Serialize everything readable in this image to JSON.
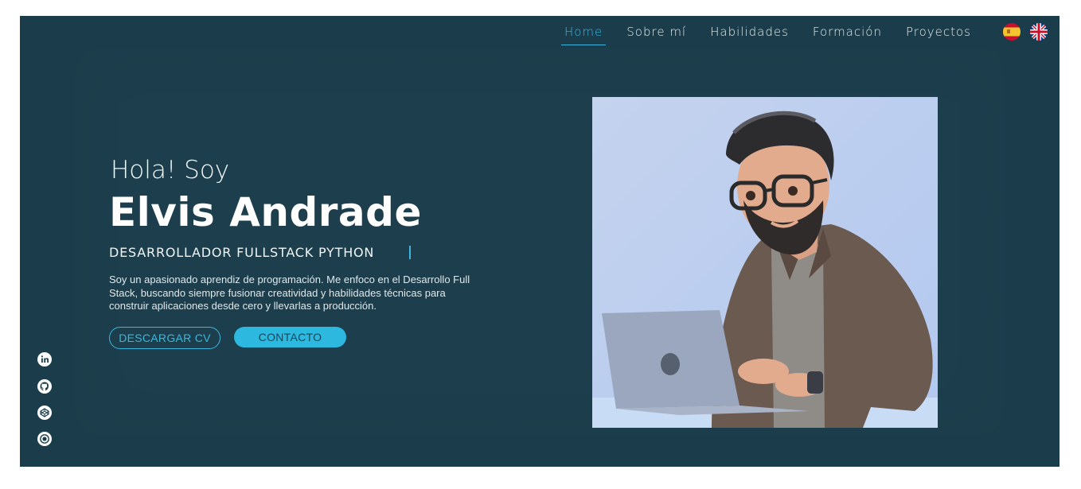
{
  "nav": {
    "items": [
      "Home",
      "Sobre mí",
      "Habilidades",
      "Formación",
      "Proyectos"
    ],
    "active": "Home",
    "flags": [
      "spanish-flag-icon",
      "uk-flag-icon"
    ]
  },
  "hero": {
    "greeting": "Hola! Soy",
    "name": "Elvis Andrade",
    "role": "DESARROLLADOR FULLSTACK PYTHON",
    "description": "Soy un apasionado aprendiz de programación. Me enfoco en el Desarrollo Full Stack, buscando siempre fusionar creatividad y habilidades técnicas para construir aplicaciones desde cero y llevarlas a producción.",
    "download_cv": "DESCARGAR CV",
    "contact": "CONTACTO"
  },
  "social": [
    "linkedin-icon",
    "github-icon",
    "codepen-icon",
    "instagram-icon"
  ],
  "colors": {
    "background": "#1b3d4b",
    "accent": "#3cb6dc",
    "button_fill": "#2db8e0"
  }
}
